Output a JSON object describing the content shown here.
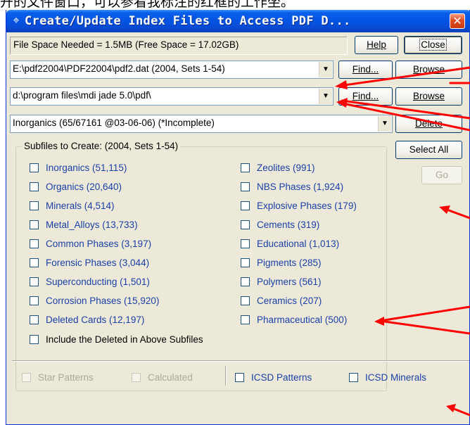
{
  "caption": "开的文件窗口，可以参看我标注的红框的工作坐。",
  "window": {
    "title": "Create/Update Index Files to Access PDF D...",
    "title_icon": "pin-icon",
    "close_glyph": "✕"
  },
  "space_info": "File Space Needed = 1.5MB (Free Space = 17.02GB)",
  "buttons": {
    "help": "Help",
    "close": "Close",
    "find1": "Find...",
    "browse1": "Browse",
    "find2": "Find...",
    "browse2": "Browse",
    "delete": "Delete",
    "select_all": "Select All",
    "go": "Go"
  },
  "inputs": {
    "data_file": "E:\\pdf22004\\PDF22004\\pdf2.dat (2004, Sets 1-54)",
    "index_dir": "d:\\program files\\mdi jade 5.0\\pdf\\",
    "subfile_select": "Inorganics (65/67161 @03-06-06) (*Incomplete)"
  },
  "subfiles": {
    "legend": "Subfiles to Create: (2004, Sets 1-54)",
    "left": [
      "Inorganics (51,115)",
      "Organics (20,640)",
      "Minerals (4,514)",
      "Metal_Alloys (13,733)",
      "Common Phases (3,197)",
      "Forensic Phases (3,044)",
      "Superconducting (1,501)",
      "Corrosion Phases (15,920)",
      "Deleted Cards (12,197)"
    ],
    "right": [
      "Zeolites (991)",
      "NBS Phases (1,924)",
      "Explosive Phases (179)",
      "Cements (319)",
      "Educational (1,013)",
      "Pigments (285)",
      "Polymers (561)",
      "Ceramics (207)",
      "Pharmaceutical (500)"
    ],
    "include_deleted": "Include the Deleted in Above Subfiles"
  },
  "bottom": {
    "star_patterns": "Star Patterns",
    "calculated": "Calculated",
    "icsd_patterns": "ICSD Patterns",
    "icsd_minerals": "ICSD Minerals"
  },
  "colors": {
    "annotation": "#ff0000",
    "link_blue": "#1a3fa8",
    "titlebar": "#0454e3"
  }
}
